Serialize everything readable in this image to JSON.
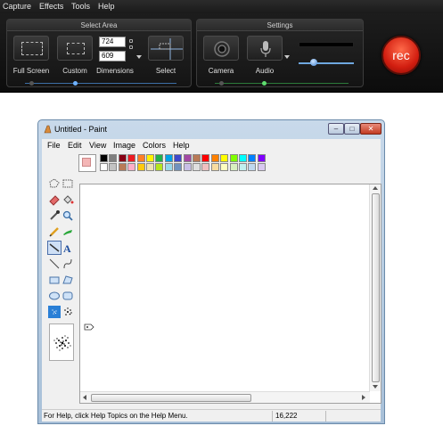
{
  "menu": [
    "Capture",
    "Effects",
    "Tools",
    "Help"
  ],
  "select_area": {
    "title": "Select Area",
    "full_screen": "Full Screen",
    "custom": "Custom",
    "width": "724",
    "height": "609",
    "dimensions": "Dimensions",
    "select": "Select"
  },
  "settings": {
    "title": "Settings",
    "camera": "Camera",
    "audio": "Audio"
  },
  "rec": "rec",
  "paint": {
    "title": "Untitled - Paint",
    "menu": [
      "File",
      "Edit",
      "View",
      "Image",
      "Colors",
      "Help"
    ],
    "palette_top": [
      "#000000",
      "#7f7f7f",
      "#880015",
      "#ed1c24",
      "#ff7f27",
      "#fff200",
      "#22b14c",
      "#00a2e8",
      "#3f48cc",
      "#a349a4",
      "#b97a57",
      "#ff0000",
      "#ff8000",
      "#ffff00",
      "#80ff00",
      "#00ffff",
      "#0080ff",
      "#8000ff"
    ],
    "palette_bottom": [
      "#ffffff",
      "#c3c3c3",
      "#b97a57",
      "#ffaec9",
      "#ffc90e",
      "#efe4b0",
      "#b5e61d",
      "#99d9ea",
      "#7092be",
      "#c8bfe7",
      "#e0e0e0",
      "#f0c0c0",
      "#f8dca0",
      "#ffffc0",
      "#d8f0c0",
      "#c0f0f0",
      "#c0d8f0",
      "#d8c8f0"
    ],
    "status_help": "For Help, click Help Topics on the Help Menu.",
    "status_coords": "16,222"
  }
}
